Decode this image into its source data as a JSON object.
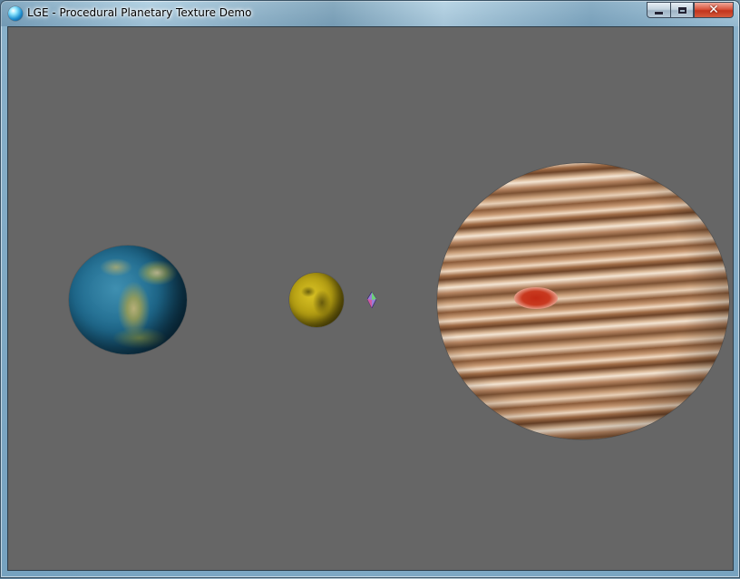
{
  "window": {
    "title": "LGE - Procedural Planetary Texture Demo",
    "app_icon": "sphere-icon",
    "controls": {
      "minimize_icon": "minimize-icon",
      "maximize_icon": "maximize-icon",
      "close_icon": "close-icon",
      "close_glyph": "✕"
    }
  },
  "scene": {
    "background_color": "#666666",
    "objects": [
      {
        "name": "earth-like-planet",
        "colors": [
          "#1f6a8e",
          "#8e9a5e",
          "#c9c59a"
        ]
      },
      {
        "name": "yellow-moon",
        "colors": [
          "#d9c224",
          "#7a6a08"
        ]
      },
      {
        "name": "gas-giant",
        "colors": [
          "#8a5a38",
          "#efd9c2",
          "#c22a14"
        ]
      },
      {
        "name": "crosshair-marker",
        "icon": "diamond-marker-icon"
      }
    ]
  }
}
